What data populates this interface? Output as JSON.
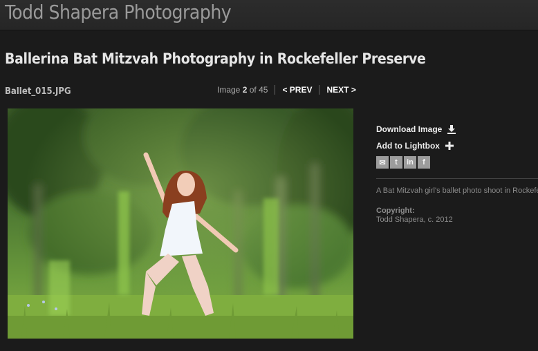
{
  "site": {
    "title": "Todd Shapera Photography"
  },
  "gallery": {
    "title": "Ballerina Bat Mitzvah Photography in Rockefeller Preserve",
    "filename": "Ballet_015.JPG"
  },
  "pager": {
    "image_word": "Image",
    "current": "2",
    "of_word": "of",
    "total": "45",
    "prev_label": "< PREV",
    "next_label": "NEXT >"
  },
  "sidebar": {
    "download_label": "Download Image",
    "download_icon": "download-icon",
    "lightbox_label": "Add to Lightbox",
    "lightbox_icon": "plus-icon",
    "share_icons": [
      "email-icon",
      "twitter-icon",
      "linkedin-icon",
      "facebook-icon"
    ],
    "share_glyphs": [
      "✉",
      "t",
      "in",
      "f"
    ],
    "caption": "A Bat Mitzvah girl's ballet photo shoot in Rockefeller Preserve",
    "copyright_label": "Copyright:",
    "copyright_value": "Todd Shapera, c. 2012"
  }
}
